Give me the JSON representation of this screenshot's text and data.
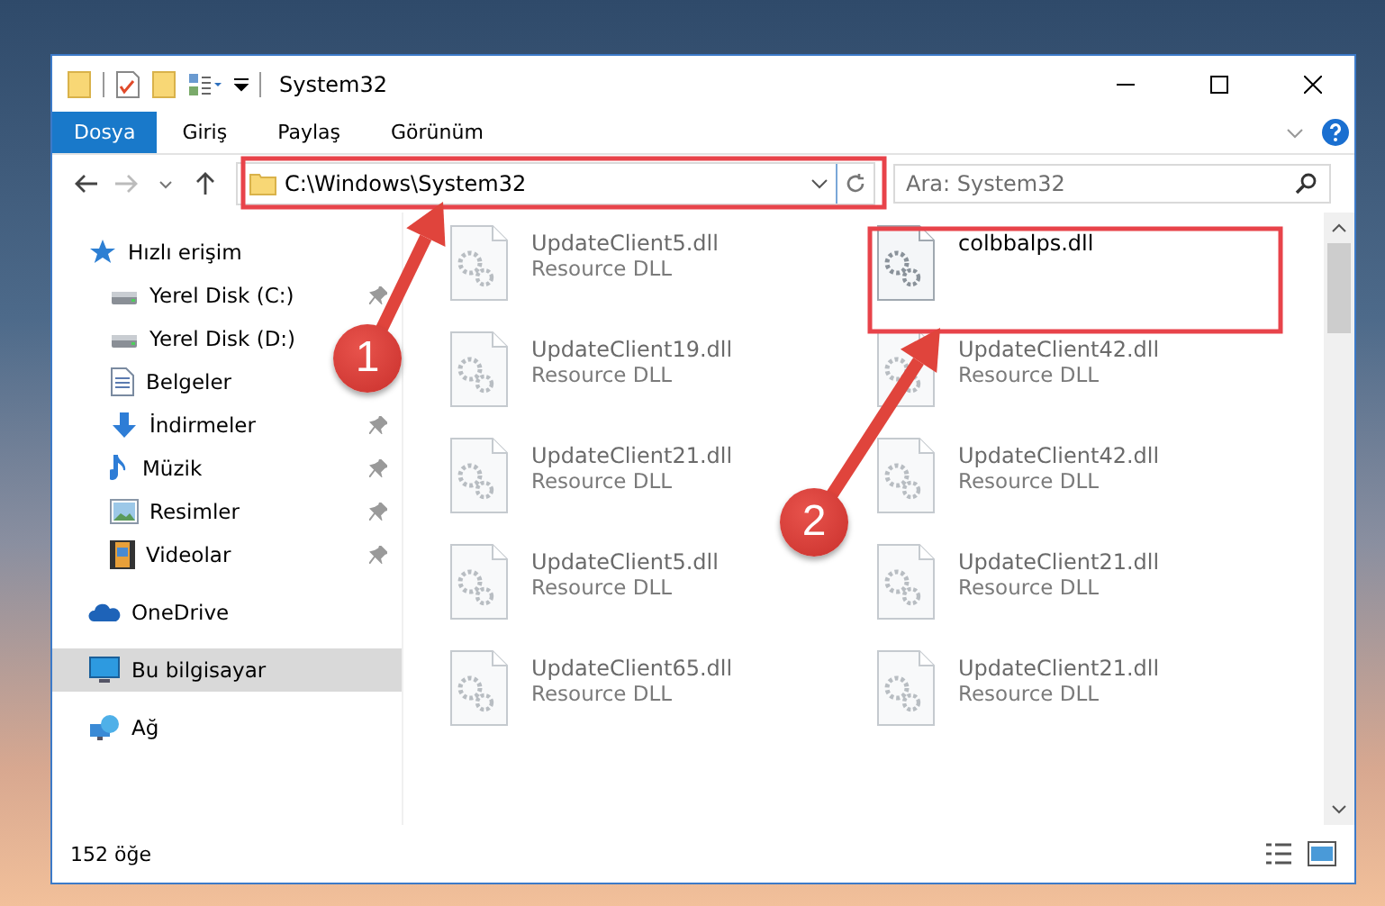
{
  "window": {
    "title": "System32"
  },
  "ribbon_tabs": [
    {
      "label": "Dosya",
      "selected": true
    },
    {
      "label": "Giriş",
      "selected": false
    },
    {
      "label": "Paylaş",
      "selected": false
    },
    {
      "label": "Görünüm",
      "selected": false
    }
  ],
  "address_bar": {
    "path": "C:\\Windows\\System32"
  },
  "search": {
    "placeholder": "Ara: System32"
  },
  "navigation": [
    {
      "label": "Hızlı erişim",
      "selected": false,
      "children": [
        {
          "label": "Yerel Disk (C:)",
          "pinned": true,
          "selected": false
        },
        {
          "label": "Yerel Disk (D:)",
          "pinned": false,
          "selected": false
        },
        {
          "label": "Belgeler",
          "pinned": false,
          "selected": false
        },
        {
          "label": "İndirmeler",
          "pinned": true,
          "selected": false
        },
        {
          "label": "Müzik",
          "pinned": true,
          "selected": false
        },
        {
          "label": "Resimler",
          "pinned": true,
          "selected": false
        },
        {
          "label": "Videolar",
          "pinned": true,
          "selected": false
        }
      ]
    },
    {
      "label": "OneDrive",
      "selected": false
    },
    {
      "label": "Bu bilgisayar",
      "selected": true
    },
    {
      "label": "Ağ",
      "selected": false
    }
  ],
  "files": [
    {
      "name": "UpdateClient5.dll",
      "type": "Resource DLL",
      "blurred": true
    },
    {
      "name": "colbbalps.dll",
      "blurred": false
    },
    {
      "name": "UpdateClient19.dll",
      "type": "Resource DLL",
      "blurred": true
    },
    {
      "name": "UpdateClient42.dll",
      "type": "Resource DLL",
      "blurred": true
    },
    {
      "name": "UpdateClient21.dll",
      "type": "Resource DLL",
      "blurred": true
    },
    {
      "name": "UpdateClient42.dll",
      "type": "Resource DLL",
      "blurred": true
    },
    {
      "name": "UpdateClient5.dll",
      "type": "Resource DLL",
      "blurred": true
    },
    {
      "name": "UpdateClient21.dll",
      "type": "Resource DLL",
      "blurred": true
    },
    {
      "name": "UpdateClient65.dll",
      "type": "Resource DLL",
      "blurred": true
    },
    {
      "name": "UpdateClient21.dll",
      "type": "Resource DLL",
      "blurred": true
    }
  ],
  "status_bar": {
    "item_count": "152 öğe"
  },
  "callouts": [
    {
      "number": "1"
    },
    {
      "number": "2"
    }
  ]
}
